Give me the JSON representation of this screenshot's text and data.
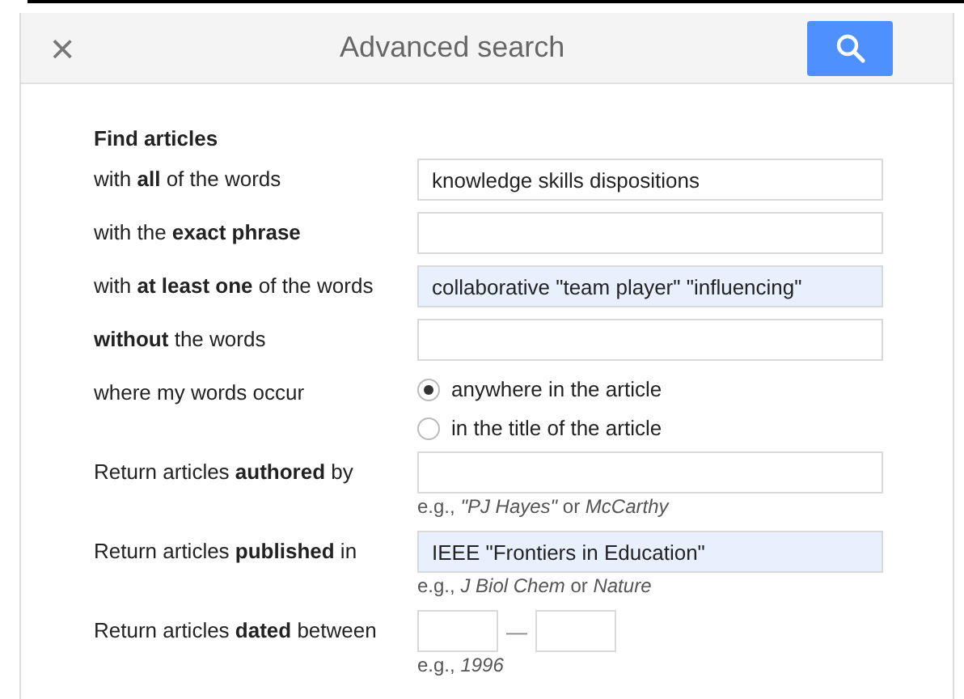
{
  "dialog": {
    "title": "Advanced search",
    "close": "×"
  },
  "section_title": "Find articles",
  "rows": [
    {
      "kind": "text",
      "label": "with **all** of the words",
      "value": "knowledge skills dispositions",
      "autofilled": false
    },
    {
      "kind": "text",
      "label": "with the **exact phrase**",
      "autofilled": false
    },
    {
      "kind": "text",
      "label": "with **at least one** of the words",
      "value": "collaborative \"team player\" \"influencing\"",
      "autofilled": true
    },
    {
      "kind": "text",
      "label": "**without** the words",
      "autofilled": false
    },
    {
      "kind": "radio",
      "label": "where my words occur",
      "options": [
        {
          "label": "anywhere in the article",
          "selected": true
        },
        {
          "label": "in the title of the article",
          "selected": false
        }
      ]
    },
    {
      "kind": "text",
      "label": "Return articles **authored** by",
      "autofilled": false,
      "hint": "e.g., *\"PJ Hayes\"* or *McCarthy*"
    },
    {
      "kind": "text",
      "label": "Return articles **published** in",
      "value": "IEEE \"Frontiers in Education\"",
      "autofilled": true,
      "hint": "e.g., *J Biol Chem* or *Nature*"
    },
    {
      "kind": "date",
      "label": "Return articles **dated** between",
      "separator": "—",
      "hint": "e.g., *1996*"
    }
  ]
}
